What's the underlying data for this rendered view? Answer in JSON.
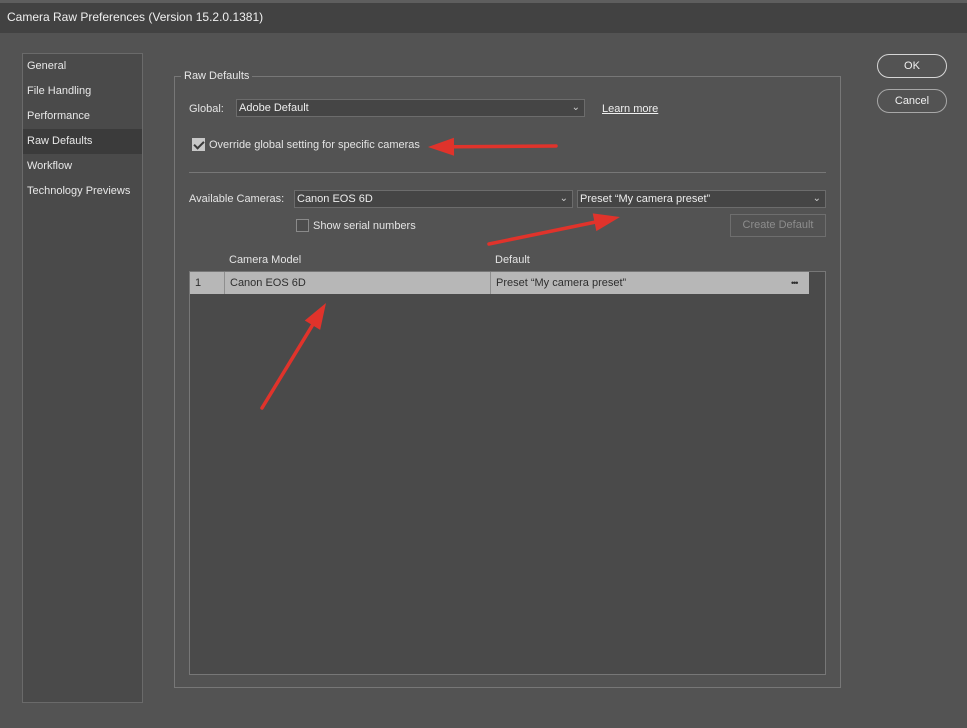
{
  "window": {
    "title": "Camera Raw Preferences  (Version 15.2.0.1381)"
  },
  "sidebar": {
    "items": [
      {
        "label": "General"
      },
      {
        "label": "File Handling"
      },
      {
        "label": "Performance"
      },
      {
        "label": "Raw Defaults",
        "active": true
      },
      {
        "label": "Workflow"
      },
      {
        "label": "Technology Previews"
      }
    ]
  },
  "dialog_buttons": {
    "ok": "OK",
    "cancel": "Cancel"
  },
  "raw_defaults": {
    "group_title": "Raw Defaults",
    "global_label": "Global:",
    "global_value": "Adobe Default",
    "learn_more": "Learn more",
    "override_label": "Override global setting for specific cameras",
    "override_checked": true,
    "available_cameras_label": "Available Cameras:",
    "camera_value": "Canon EOS 6D",
    "preset_value": "Preset “My camera preset”",
    "show_serial_label": "Show serial numbers",
    "show_serial_checked": false,
    "create_default": "Create Default",
    "table": {
      "headers": {
        "model": "Camera Model",
        "default": "Default"
      },
      "rows": [
        {
          "index": "1",
          "model": "Canon EOS 6D",
          "default": "Preset “My camera preset”",
          "more": "•••"
        }
      ]
    }
  },
  "colors": {
    "annotation_arrow": "#e0332b"
  }
}
